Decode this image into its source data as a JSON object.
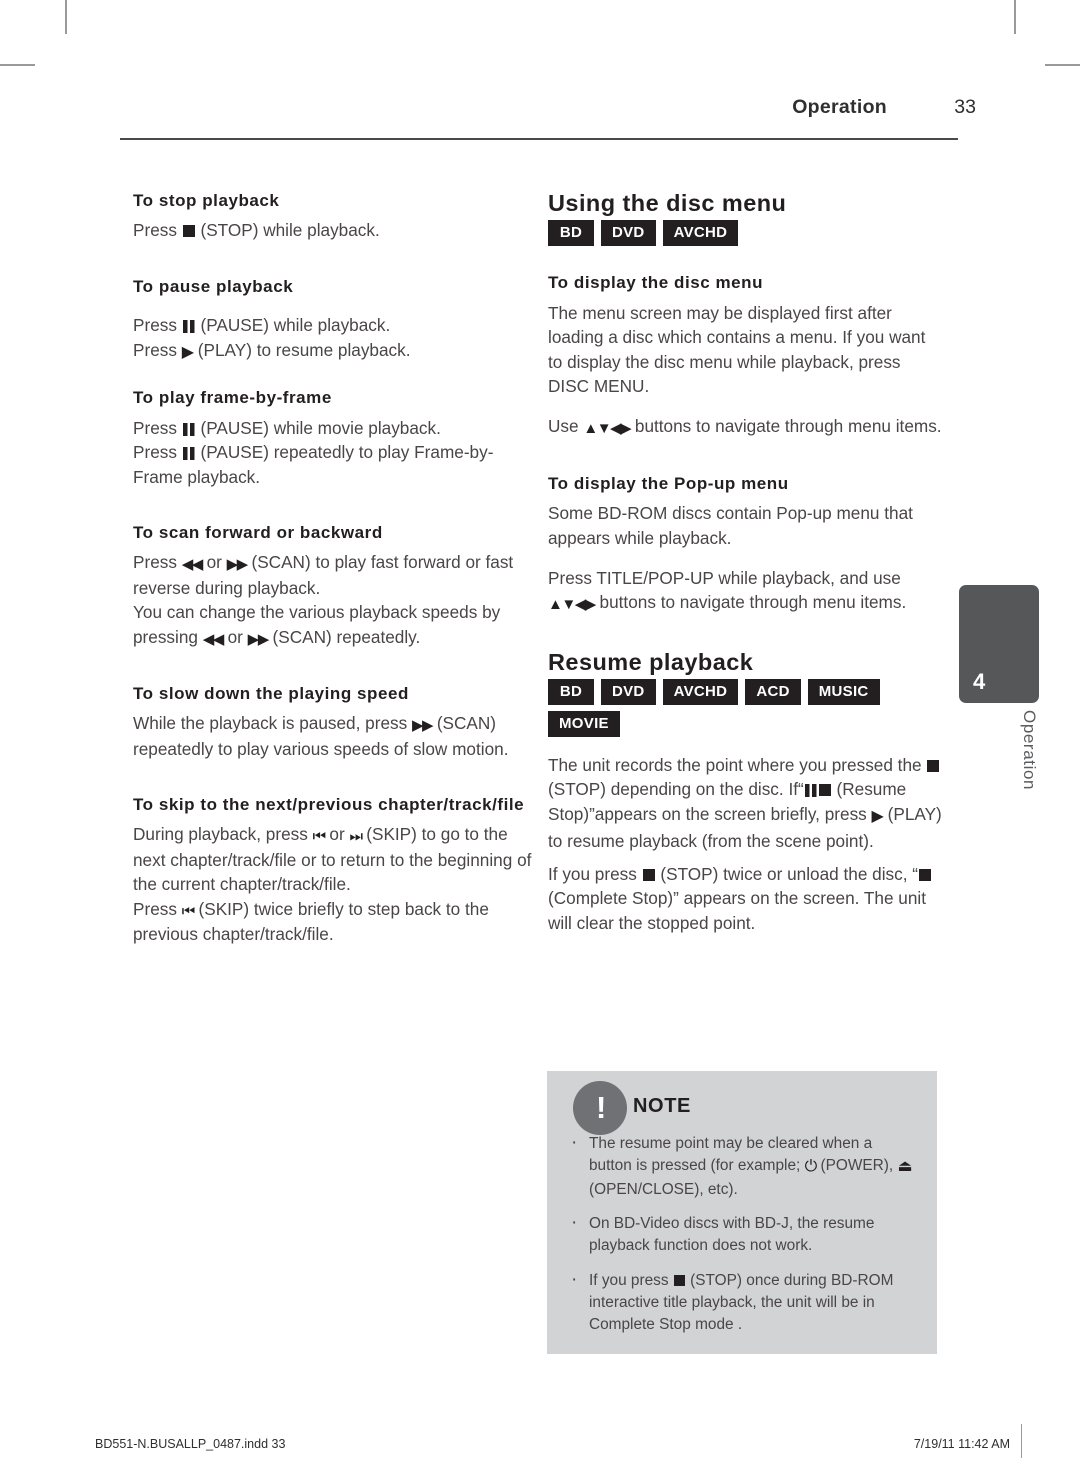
{
  "header": {
    "section": "Operation",
    "page_number": "33"
  },
  "side_tab": {
    "number": "4",
    "label": "Operation"
  },
  "left_column": {
    "sections": [
      {
        "heading": "To stop playback",
        "paragraphs": [
          "Press ■ (STOP) while playback."
        ]
      },
      {
        "heading": "To pause playback",
        "paragraphs": [
          "Press ▐▌ (PAUSE) while playback.",
          "Press ▶ (PLAY) to resume playback."
        ]
      },
      {
        "heading": "To play frame-by-frame",
        "paragraphs": [
          "Press ▐▌ (PAUSE) while movie playback.",
          "Press ▐▌ (PAUSE) repeatedly to play Frame-by-Frame playback."
        ]
      },
      {
        "heading": "To scan forward or backward",
        "paragraphs": [
          "Press ◀◀ or ▶▶ (SCAN) to play fast forward or fast reverse during playback.",
          "You can change the various playback speeds by pressing ◀◀ or ▶▶ (SCAN) repeatedly."
        ]
      },
      {
        "heading": "To slow down the playing speed",
        "paragraphs": [
          "While the playback is paused, press ▶▶ (SCAN) repeatedly to play various speeds of slow motion."
        ]
      },
      {
        "heading": "To skip to the next/previous chapter/track/file",
        "paragraphs": [
          "During playback, press ◀◀▌ or ▶▶▌ (SKIP) to go to the next chapter/track/file or to return to the beginning of the current chapter/track/file.",
          "Press ◀◀▌ (SKIP) twice briefly to step back to the previous chapter/track/file."
        ]
      }
    ]
  },
  "right_column": {
    "disc_menu": {
      "title": "Using the disc menu",
      "badges": [
        "BD",
        "DVD",
        "AVCHD"
      ],
      "subsections": [
        {
          "heading": "To display the disc menu",
          "paragraphs": [
            "The menu screen may be displayed first after loading a disc which contains a menu. If you want to display the disc menu while playback, press DISC MENU.",
            "Use ▲▼◀▶ buttons to navigate through menu items."
          ]
        },
        {
          "heading": "To display the Pop-up menu",
          "paragraphs": [
            "Some BD-ROM discs contain Pop-up menu that appears while playback.",
            "Press TITLE/POP-UP while playback, and use ▲▼◀▶ buttons to navigate through menu items."
          ]
        }
      ]
    },
    "resume_playback": {
      "title": "Resume playback",
      "badges": [
        "BD",
        "DVD",
        "AVCHD",
        "ACD",
        "MUSIC",
        "MOVIE"
      ],
      "paragraphs": [
        "The unit records the point where you pressed the ■ (STOP) depending on the disc. If “▐▌■ (Resume Stop)” appears on the screen briefly, press ▶ (PLAY) to resume playback (from the scene point).",
        "If you press ■ (STOP) twice or unload the disc, “■(Complete Stop)” appears on the screen. The unit will clear the stopped point."
      ]
    }
  },
  "note": {
    "title": "NOTE",
    "icon": "exclamation-icon",
    "items": [
      "The resume point may be cleared when a button is pressed (for example; ⏻ (POWER), ⏏ (OPEN/CLOSE), etc).",
      "On BD-Video discs with BD-J, the resume playback function does not work.",
      "If you press ■ (STOP) once during BD-ROM interactive title playback, the unit will be in Complete Stop mode ."
    ]
  },
  "footer": {
    "file": "BD551-N.BUSALLP_0487.indd   33",
    "timestamp": "7/19/11   11:42 AM"
  }
}
